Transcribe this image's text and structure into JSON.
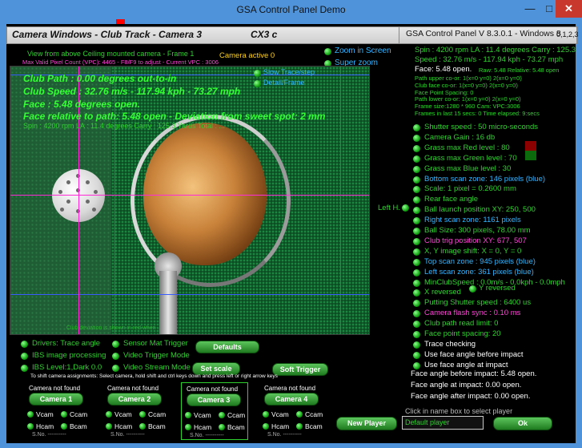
{
  "window": {
    "title": "GSA Control Panel Demo",
    "min": "—",
    "max": "□",
    "close": "✕"
  },
  "header": {
    "title": "Camera Windows - Club Track - Camera 3",
    "cx": "CX3 c",
    "version": "GSA Control Panel V 8.3.0.1 - Windows 8",
    "sub": "0,1,2,3"
  },
  "camera_info": {
    "view_from": "View from above Ceiling mounted camera - Frame 1",
    "max_valid": "Max Valid Pixel Count (VPC): 4465 - F8/F9 to adjust - Current VPC : 3006",
    "camera_active": "Camera active 0",
    "zoom_in_screen": "Zoom in Screen",
    "super_zoom": "Super zoom",
    "slow_trace": "Slow Trace/step",
    "detail": "Detail/Frame"
  },
  "overlay": {
    "club_path": "Club Path : 0.00 degrees out-to-in",
    "club_speed": "Club Speed : 32.76 m/s - 117.94 kph - 73.27 mph",
    "face": "Face : 5.48 degrees open.",
    "face_rel": "Face relative to path: 5.48 open - Deviation from sweet spot: 2 mm",
    "spin_line": "Spin : 4200 rpm  LA : 11.4 degrees  Carry : 125.3 Yards  Total : ...",
    "bottom_note": "Club deviation is shown in red when ..."
  },
  "stats": {
    "spin": "Spin : 4200 rpm  LA : 11.4 degrees  Carry : 125.3",
    "speed": "Speed : 32.76 m/s - 117.94 kph - 73.27 mph",
    "face": "Face: 5.48 open.",
    "raw": "Raw: 5.48 Relative: 5.48 open",
    "path_upper": "Path upper co-or: 1(x=0 y=0) 2(x=0 y=0)",
    "club_face": "Club face co-or: 1(x=0 y=0) 2(x=0 y=0)",
    "face_point": "Face Point Spacing: 0",
    "path_lower": "Path lower co-or: 1(x=0 y=0) 2(x=0 y=0)",
    "frame_size": "Frame size:1280 * 960 Cam: VPC:3006",
    "frames_last": "Frames in last 15 secs: 0 Time elapsed:    9:secs"
  },
  "settings": [
    {
      "label": "Shutter speed : 50 micro-seconds",
      "color": "#2fd12f"
    },
    {
      "label": "Camera Gain : 16 db",
      "color": "#2fd12f"
    },
    {
      "label": "Grass max Red level : 80",
      "color": "#2fd12f"
    },
    {
      "label": "Grass max Green level : 70",
      "color": "#2fd12f"
    },
    {
      "label": "Grass max Blue level : 30",
      "color": "#2fd12f"
    },
    {
      "label": "Bottom scan zone: 146 pixels (blue)",
      "color": "#33b6ff"
    },
    {
      "label": "Scale: 1 pixel = 0.2600 mm",
      "color": "#2fd12f"
    },
    {
      "label": "Rear face angle",
      "color": "#2fd12f"
    },
    {
      "label": "Ball launch position XY: 250, 500",
      "color": "#2fd12f"
    },
    {
      "label": "Right scan zone: 1161 pixels",
      "color": "#33b6ff"
    },
    {
      "label": "Ball Size: 300 pixels, 78.00 mm",
      "color": "#2fd12f"
    },
    {
      "label": "Club trig position XY: 677, 507",
      "color": "#ff44d8"
    },
    {
      "label": "X, Y image shift: X = 0,  Y = 0",
      "color": "#2fd12f"
    },
    {
      "label": "Top scan zone : 945 pixels (blue)",
      "color": "#33b6ff"
    },
    {
      "label": "Left scan zone: 361 pixels (blue)",
      "color": "#33b6ff"
    },
    {
      "label": "MinClubSpeed : 0.0m/s - 0.0kph - 0.0mph",
      "color": "#2fd12f"
    },
    {
      "label": "X reversed",
      "color": "#2fd12f"
    },
    {
      "label": "Putting Shutter speed : 6400 us",
      "color": "#2fd12f"
    },
    {
      "label": "Camera flash sync :  0.10 ms",
      "color": "#ff44d8"
    },
    {
      "label": "Club path read limit: 0",
      "color": "#2fd12f"
    },
    {
      "label": "Face point spacing: 20",
      "color": "#2fd12f"
    },
    {
      "label": "Trace checking",
      "color": "#ffffff"
    },
    {
      "label": "Use face angle before impact",
      "color": "#ffffff"
    },
    {
      "label": "Use face angle at impact",
      "color": "#ffffff"
    }
  ],
  "y_reversed": "Y reversed",
  "left_h": "Left H.",
  "face_angles": {
    "before": "Face angle before impact: 5.48 open.",
    "at": "Face angle at impact:        0.00 open.",
    "after": "Face angle after impact:    0.00 open."
  },
  "checks": {
    "drivers": "Drivers: Trace angle",
    "sensor": "Sensor Mat Trigger",
    "ibs": "IBS image processing",
    "video_trigger": "Video Trigger Mode",
    "ibs_level": "IBS Level:1,Dark 0.0",
    "video_stream": "Video Stream Mode"
  },
  "buttons": {
    "defaults": "Defaults",
    "set_scale": "Set scale",
    "soft_trigger": "Soft Trigger",
    "new_player": "New Player",
    "ok": "Ok"
  },
  "shift_note": "To shift camera assignments: Select camera, hold shift and ctrl keys down and press left or right arrow keys",
  "player": {
    "hint": "Click in name box to select player",
    "value": "Default player"
  },
  "cameras": [
    {
      "status": "Camera not found",
      "name": "Camera 1",
      "vcam": "Vcam",
      "ccam": "Ccam",
      "hcam": "Hcam",
      "bcam": "Bcam",
      "sno": "S.No. ----------"
    },
    {
      "status": "Camera not found",
      "name": "Camera 2",
      "vcam": "Vcam",
      "ccam": "Ccam",
      "hcam": "Hcam",
      "bcam": "Bcam",
      "sno": "S.No. ----------"
    },
    {
      "status": "Camera not found",
      "name": "Camera 3",
      "vcam": "Vcam",
      "ccam": "Ccam",
      "hcam": "Hcam",
      "bcam": "Bcam",
      "sno": "S.No. ----------"
    },
    {
      "status": "Camera not found",
      "name": "Camera 4",
      "vcam": "Vcam",
      "ccam": "Ccam",
      "hcam": "Hcam",
      "bcam": "Bcam",
      "sno": "S.No. ----------"
    }
  ]
}
